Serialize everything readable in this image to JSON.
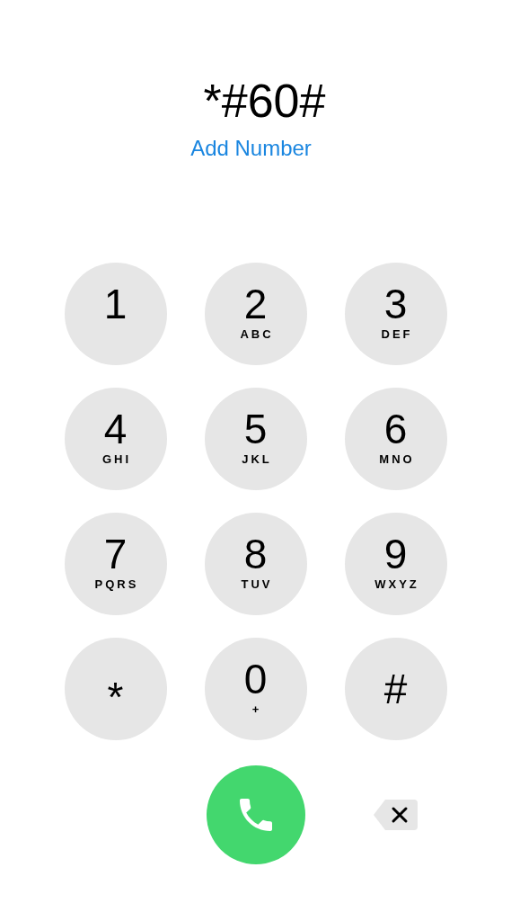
{
  "display": {
    "number": "*#60#",
    "action": "Add Number"
  },
  "keys": [
    {
      "kind": "digit",
      "main": "1"
    },
    {
      "kind": "digit",
      "main": "2",
      "letters": "ABC"
    },
    {
      "kind": "digit",
      "main": "3",
      "letters": "DEF"
    },
    {
      "kind": "digit",
      "main": "4",
      "letters": "GHI"
    },
    {
      "kind": "digit",
      "main": "5",
      "letters": "JKL"
    },
    {
      "kind": "digit",
      "main": "6",
      "letters": "MNO"
    },
    {
      "kind": "digit",
      "main": "7",
      "letters": "PQRS"
    },
    {
      "kind": "digit",
      "main": "8",
      "letters": "TUV"
    },
    {
      "kind": "digit",
      "main": "9",
      "letters": "WXYZ"
    },
    {
      "kind": "symbol",
      "main": "*"
    },
    {
      "kind": "digit",
      "main": "0",
      "letters": "+"
    },
    {
      "kind": "symbol",
      "main": "#"
    }
  ]
}
